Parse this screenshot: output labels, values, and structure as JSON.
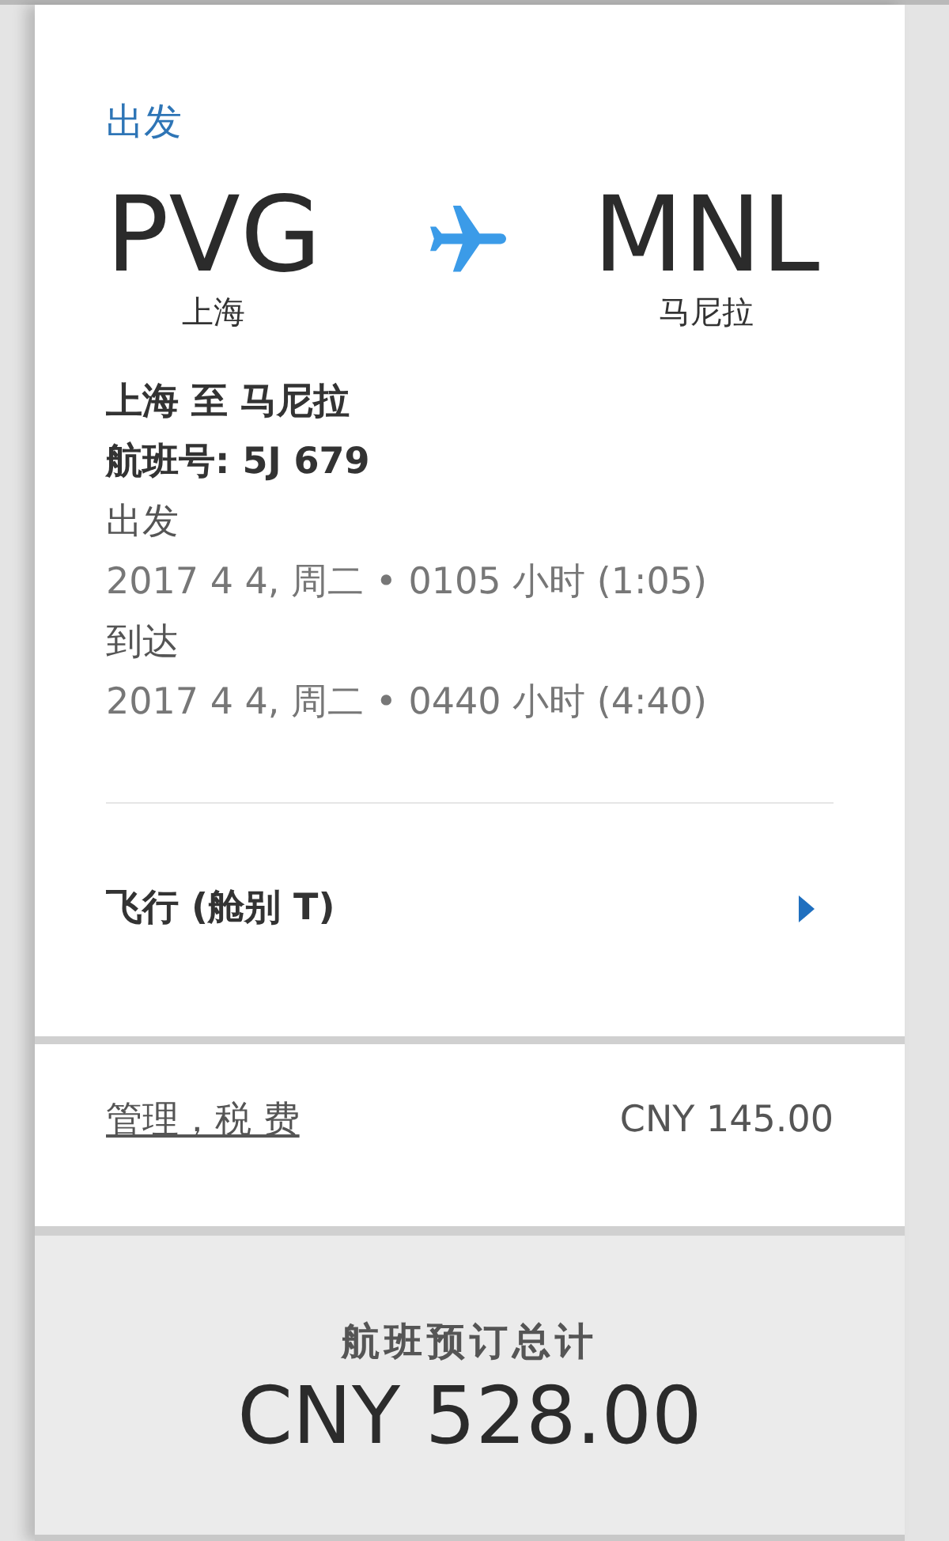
{
  "flight": {
    "direction_label": "出发",
    "origin": {
      "code": "PVG",
      "city": "上海"
    },
    "destination": {
      "code": "MNL",
      "city": "马尼拉"
    },
    "route": "上海 至 马尼拉",
    "flight_number": "航班号: 5J 679",
    "schedule": [
      {
        "label": "出发",
        "time": "2017 4 4, 周二 • 0105 小时 (1:05)"
      },
      {
        "label": "到达",
        "time": "2017 4 4, 周二 • 0440 小时 (4:40)"
      }
    ],
    "cabin": {
      "label": "飞行 (舱别 T)",
      "expanded": false
    }
  },
  "fees": {
    "label": "管理，税 费",
    "amount": "CNY 145.00"
  },
  "total": {
    "label": "航班预订总计",
    "amount": "CNY 528.00"
  }
}
